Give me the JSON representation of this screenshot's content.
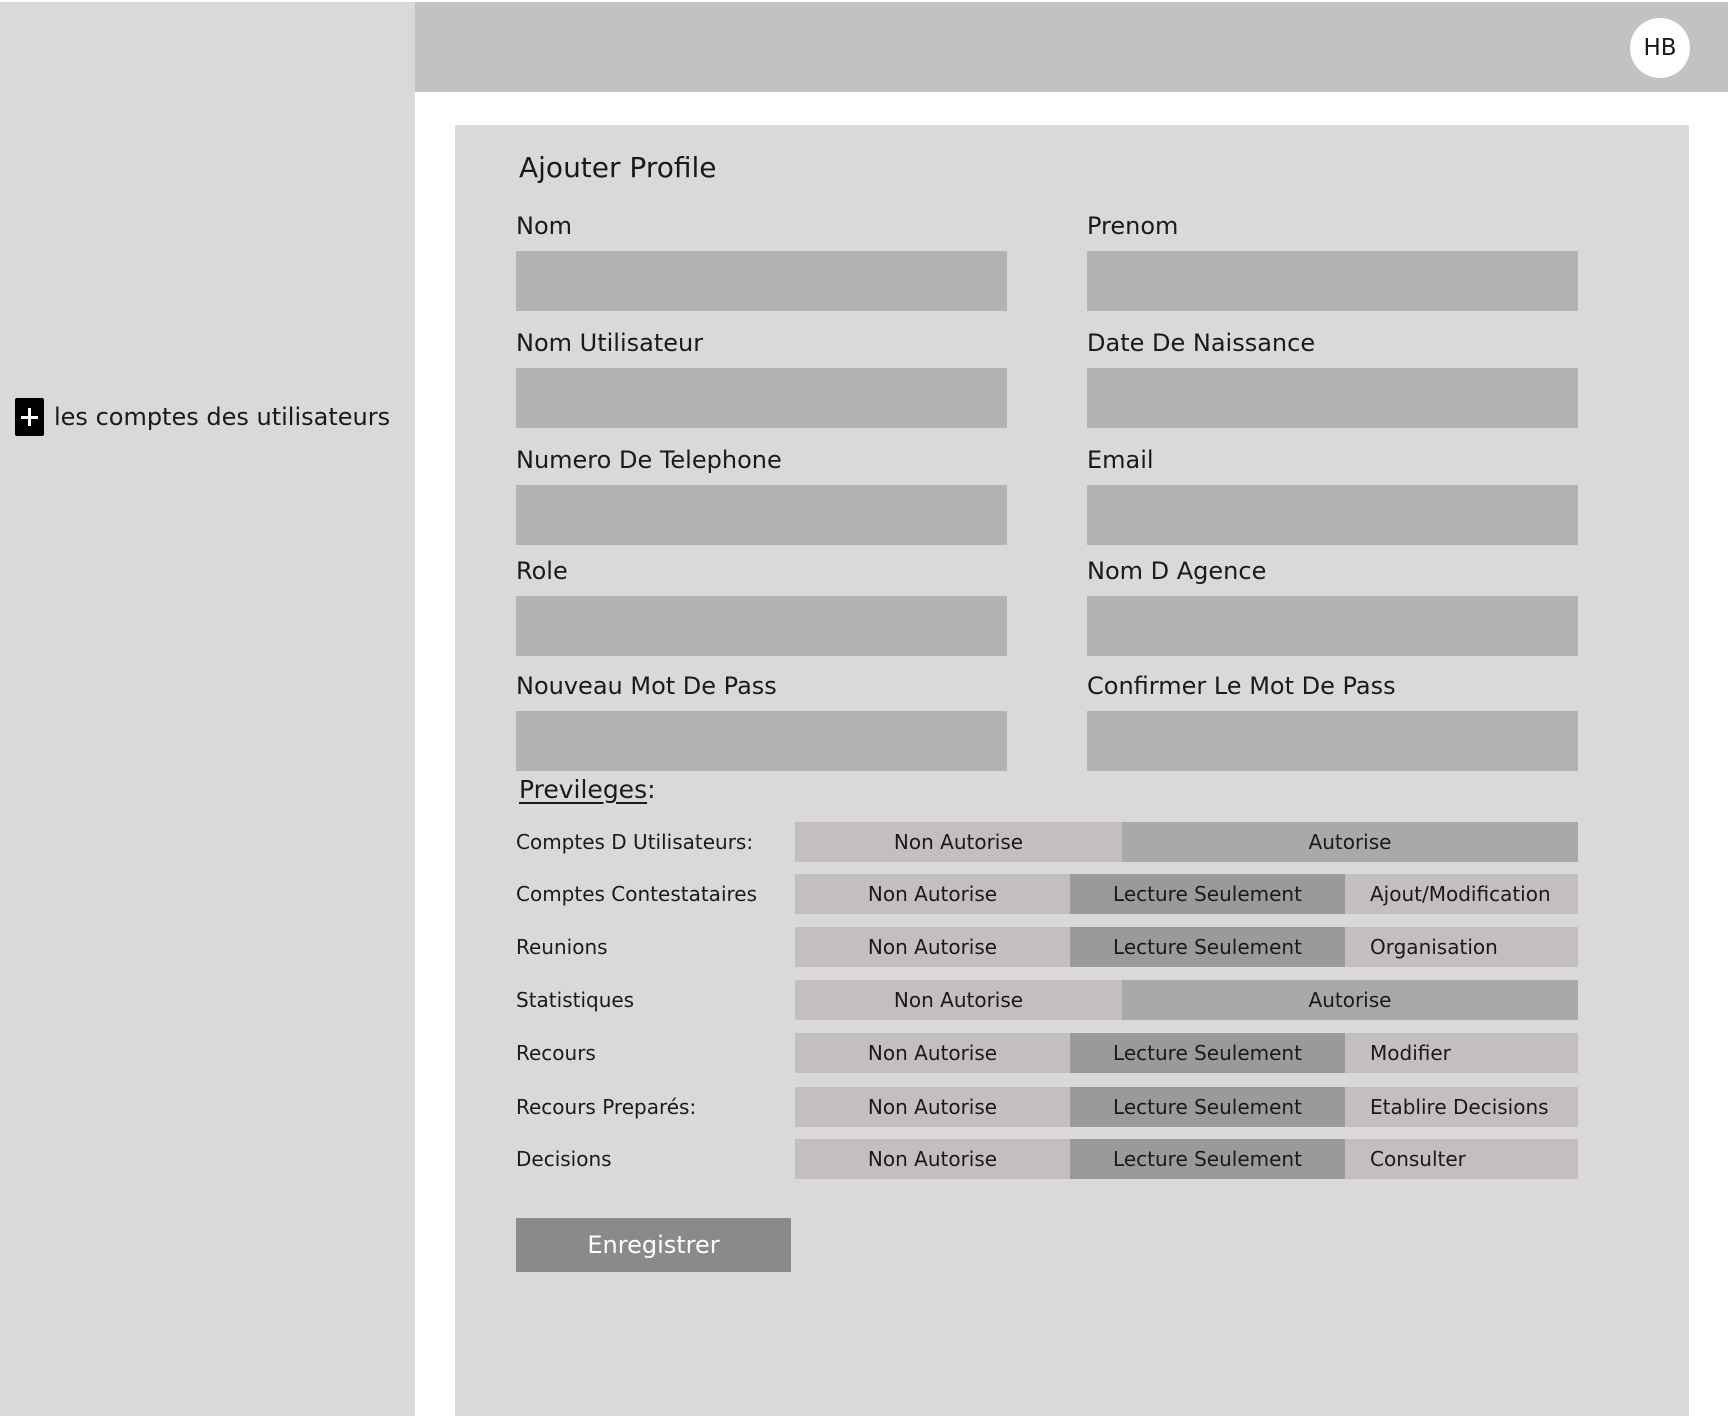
{
  "sidebar": {
    "items": [
      {
        "label": "les comptes des utilisateurs",
        "icon": "plus-icon"
      }
    ]
  },
  "header": {
    "avatar_initials": "HB"
  },
  "form": {
    "title": "Ajouter Profile",
    "fields": {
      "nom": {
        "label": "Nom",
        "value": "",
        "placeholder": ""
      },
      "prenom": {
        "label": "Prenom",
        "value": "",
        "placeholder": ""
      },
      "nom_utilisateur": {
        "label": "Nom Utilisateur",
        "value": "",
        "placeholder": ""
      },
      "date_naissance": {
        "label": "Date De Naissance",
        "value": "",
        "placeholder": ""
      },
      "telephone": {
        "label": "Numero De Telephone",
        "value": "",
        "placeholder": ""
      },
      "email": {
        "label": "Email",
        "value": "",
        "placeholder": ""
      },
      "role": {
        "label": "Role",
        "value": "",
        "placeholder": ""
      },
      "agence": {
        "label": "Nom D Agence",
        "value": "",
        "placeholder": ""
      },
      "nouveau_mdp": {
        "label": "Nouveau Mot De Pass",
        "value": "",
        "placeholder": ""
      },
      "confirmer_mdp": {
        "label": "Confirmer Le Mot De Pass",
        "value": "",
        "placeholder": ""
      }
    },
    "privileges": {
      "title": "Previleges",
      "title_suffix": ":",
      "rows": [
        {
          "label": "Comptes D Utilisateurs:",
          "options": [
            "Non Autorise",
            "Autorise"
          ]
        },
        {
          "label": "Comptes Contestataires",
          "options": [
            "Non Autorise",
            "Lecture Seulement",
            "Ajout/Modification"
          ]
        },
        {
          "label": "Reunions",
          "options": [
            "Non Autorise",
            "Lecture Seulement",
            "Organisation"
          ]
        },
        {
          "label": "Statistiques",
          "options": [
            "Non Autorise",
            "Autorise"
          ]
        },
        {
          "label": "Recours",
          "options": [
            "Non Autorise",
            "Lecture Seulement",
            "Modifier"
          ]
        },
        {
          "label": "Recours Preparés:",
          "options": [
            "Non Autorise",
            "Lecture Seulement",
            "Etablire Decisions"
          ]
        },
        {
          "label": "Decisions",
          "options": [
            "Non Autorise",
            "Lecture Seulement",
            "Consulter"
          ]
        }
      ]
    },
    "save_label": "Enregistrer"
  },
  "colors": {
    "sidebar_bg": "#d9d9d9",
    "topbar_bg": "#c2c2c2",
    "input_bg": "#b2b2b2",
    "option_light": "#c4bebe",
    "option_selected": "#9a9a9a",
    "save_button": "#8a8a8a"
  }
}
